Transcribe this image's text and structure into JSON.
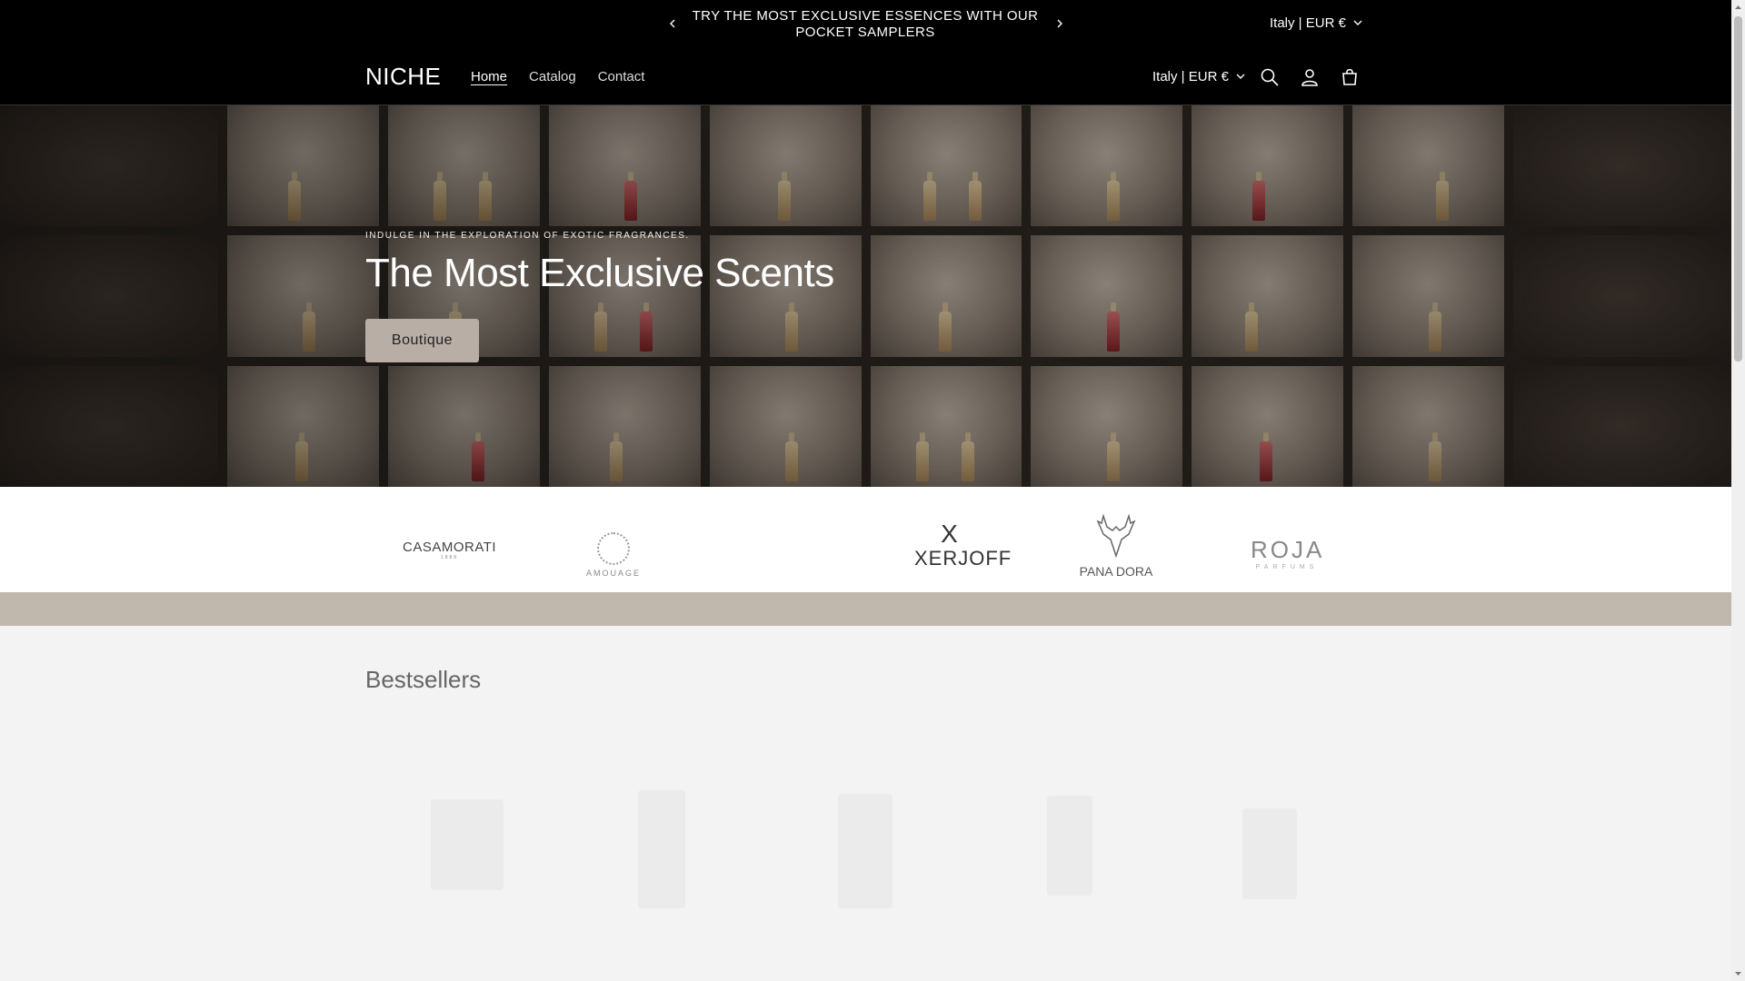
{
  "announcement": {
    "message": "TRY THE MOST EXCLUSIVE ESSENCES WITH OUR POCKET SAMPLERS",
    "locale": "Italy | EUR €"
  },
  "header": {
    "logo": "NICHE",
    "nav": [
      {
        "label": "Home",
        "active": true
      },
      {
        "label": "Catalog",
        "active": false
      },
      {
        "label": "Contact",
        "active": false
      }
    ],
    "locale": "Italy | EUR €"
  },
  "hero": {
    "subtitle": "INDULGE IN THE EXPLORATION OF EXOTIC FRAGRANCES.",
    "title": "The Most Exclusive Scents",
    "button_label": "Boutique"
  },
  "brands": {
    "casamorati": {
      "name": "CASAMORATI",
      "year": "1888"
    },
    "amouage": {
      "name": "AMOUAGE"
    },
    "xerjoff": {
      "mark": "X",
      "name": "XERJOFF"
    },
    "panadora": {
      "name": "PANA DORA"
    },
    "roja": {
      "name": "ROJA",
      "sub": "PARFUMS"
    }
  },
  "bestsellers": {
    "title": "Bestsellers"
  },
  "colors": {
    "header_bg": "#000000",
    "button_bg": "#b8aea6",
    "tan_bar": "#c0b7ad",
    "page_bg": "#f3f3f3"
  }
}
